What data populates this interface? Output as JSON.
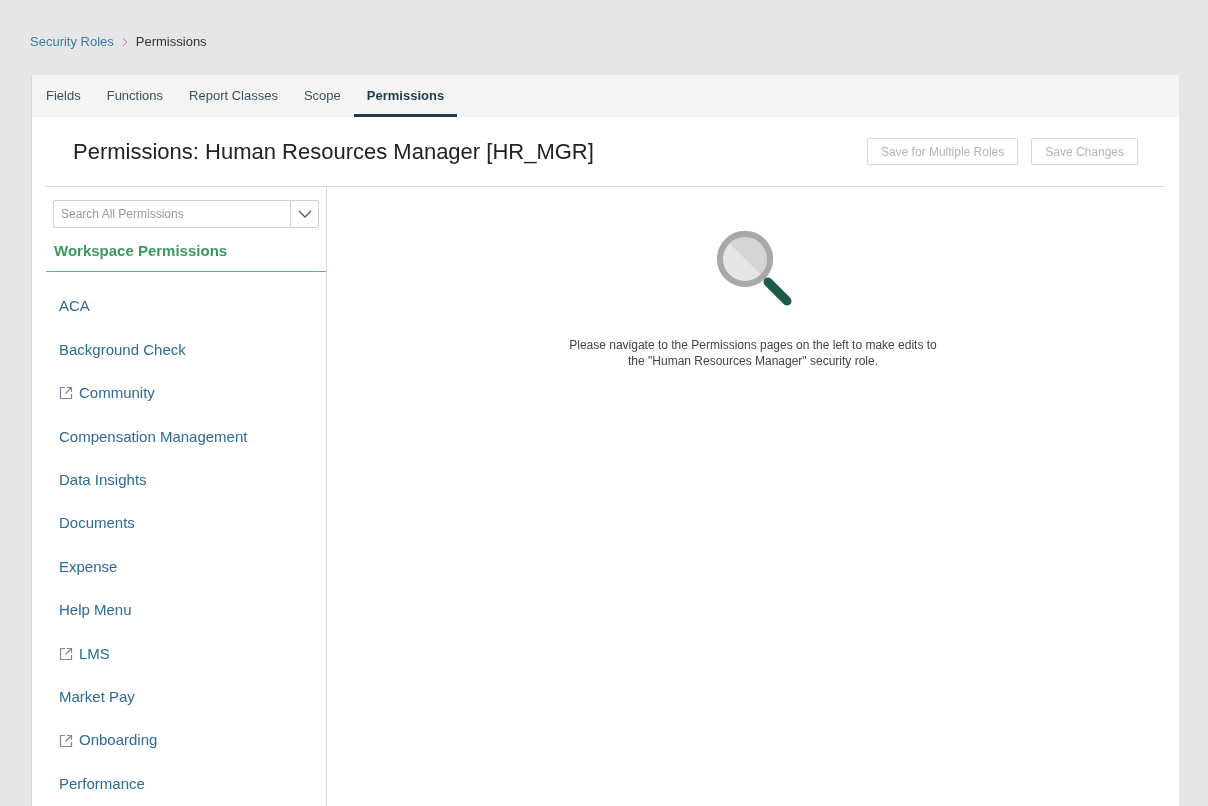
{
  "breadcrumb": [
    {
      "label": "Security Roles",
      "kind": "link"
    },
    {
      "label": "Permissions",
      "kind": "current"
    }
  ],
  "tabs": [
    {
      "label": "Fields",
      "selected": false
    },
    {
      "label": "Functions",
      "selected": false
    },
    {
      "label": "Report Classes",
      "selected": false
    },
    {
      "label": "Scope",
      "selected": false
    },
    {
      "label": "Permissions",
      "selected": true
    }
  ],
  "title": "Permissions: Human Resources Manager [HR_MGR]",
  "buttons": [
    {
      "label": "Save for Multiple Roles",
      "disabled": true
    },
    {
      "label": "Save Changes",
      "disabled": true
    }
  ],
  "search": {
    "placeholder": "Search All Permissions"
  },
  "section_title": "Workspace Permissions",
  "items": [
    {
      "label": "ACA",
      "external": false
    },
    {
      "label": "Background Check",
      "external": false
    },
    {
      "label": "Community",
      "external": true
    },
    {
      "label": "Compensation Management",
      "external": false
    },
    {
      "label": "Data Insights",
      "external": false
    },
    {
      "label": "Documents",
      "external": false
    },
    {
      "label": "Expense",
      "external": false
    },
    {
      "label": "Help Menu",
      "external": false
    },
    {
      "label": "LMS",
      "external": true
    },
    {
      "label": "Market Pay",
      "external": false
    },
    {
      "label": "Onboarding",
      "external": true
    },
    {
      "label": "Performance",
      "external": false
    }
  ],
  "message": "Please navigate to the Permissions pages on the left to make edits to the \"Human Resources Manager\" security role."
}
